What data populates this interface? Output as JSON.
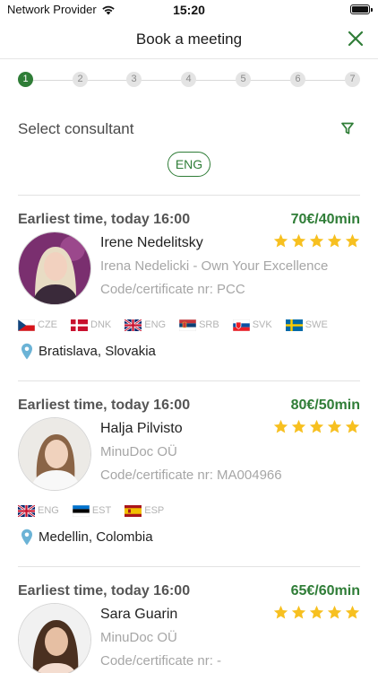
{
  "status_bar": {
    "carrier": "Network Provider",
    "time": "15:20"
  },
  "header": {
    "title": "Book a meeting"
  },
  "stepper": {
    "steps": [
      "1",
      "2",
      "3",
      "4",
      "5",
      "6",
      "7"
    ],
    "active_step": 1
  },
  "filter": {
    "label": "Select consultant",
    "language_chip": "ENG"
  },
  "colors": {
    "accent": "#2f7d37",
    "star": "#f7c020",
    "pin": "#6bb3d6"
  },
  "consultants": [
    {
      "earliest": "Earliest time, today 16:00",
      "price": "70€/40min",
      "name": "Irene Nedelitsky",
      "rating": 5,
      "company": "Irena Nedelicki - Own Your Excellence",
      "certificate": "Code/certificate nr: PCC",
      "languages": [
        "CZE",
        "DNK",
        "ENG",
        "SRB",
        "SVK",
        "SWE"
      ],
      "location": "Bratislava, Slovakia"
    },
    {
      "earliest": "Earliest time, today 16:00",
      "price": "80€/50min",
      "name": "Halja Pilvisto",
      "rating": 5,
      "company": "MinuDoc OÜ",
      "certificate": "Code/certificate nr: MA004966",
      "languages": [
        "ENG",
        "EST",
        "ESP"
      ],
      "location": "Medellin, Colombia"
    },
    {
      "earliest": "Earliest time, today 16:00",
      "price": "65€/60min",
      "name": "Sara Guarin",
      "rating": 5,
      "company": "MinuDoc OÜ",
      "certificate": "Code/certificate nr: -",
      "languages": [],
      "location": ""
    }
  ]
}
